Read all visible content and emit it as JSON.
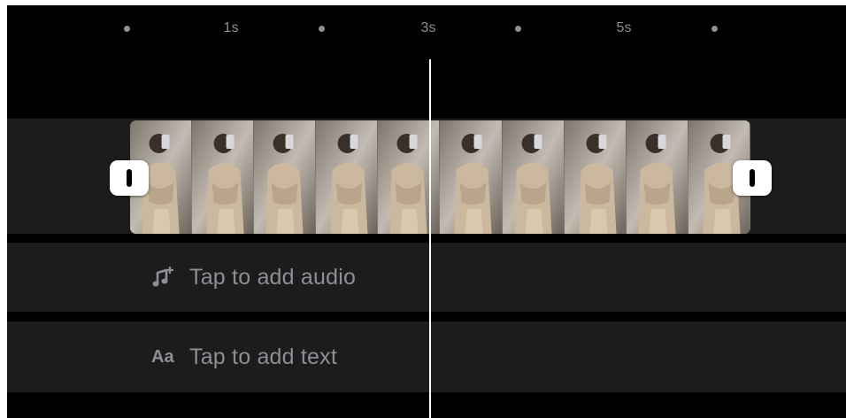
{
  "ruler": {
    "ticks": [
      "",
      "1s",
      "",
      "3s",
      "",
      "5s",
      ""
    ]
  },
  "video_track": {
    "frame_count": 10,
    "trim_handles": [
      "left",
      "right"
    ]
  },
  "audio_track": {
    "icon": "music-note-plus-icon",
    "label": "Tap to add audio"
  },
  "text_track": {
    "icon": "text-aa-icon",
    "icon_text": "Aa",
    "label": "Tap to add text"
  },
  "colors": {
    "background": "#000000",
    "track": "#1c1c1e",
    "hint_text": "#8e8e93",
    "playhead": "#ffffff"
  }
}
